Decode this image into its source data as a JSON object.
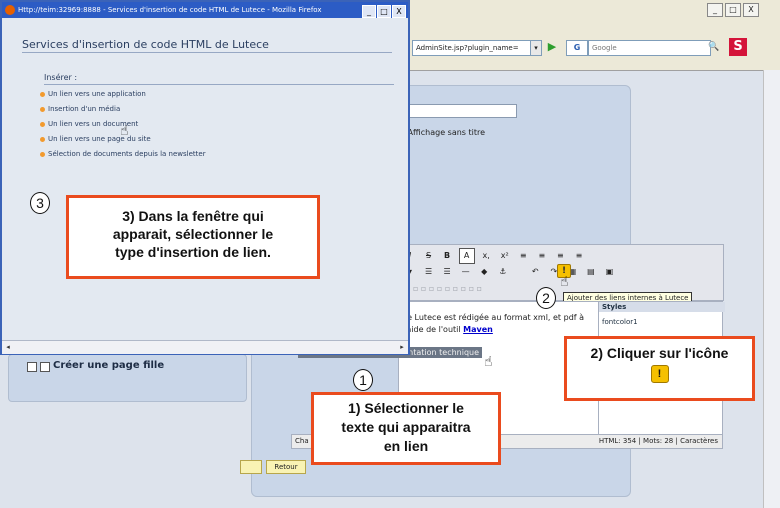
{
  "popup": {
    "window_title": "Http://teim:32969:8888 - Services d'insertion de code HTML de Lutece - Mozilla Firefox",
    "heading": "Services d'insertion de code HTML de Lutece",
    "insert_label": "Insérer :",
    "items": [
      "Un lien vers une application",
      "Insertion d'un média",
      "Un lien vers un document",
      "Un lien vers une page du site",
      "Sélection de documents depuis la newsletter"
    ],
    "controls": [
      "_",
      "□",
      "X"
    ]
  },
  "browser": {
    "url": "AdminSite.jsp?plugin_name=",
    "search_placeholder": "Google",
    "search_engine_icon": "G",
    "logo": "S",
    "window_controls": [
      "_",
      "□",
      "X"
    ]
  },
  "editor": {
    "radio_label": "Affichage sans titre",
    "toolbar_row1": [
      "I",
      "S",
      "B",
      "A",
      "x,",
      "x²"
    ],
    "tooltip": "Ajouter des liens internes à Lutece",
    "body_text": "de Lutece est rédigée au format xml, et pdf à l'aide de l'outil",
    "body_link": "Maven",
    "selected_text": "Présentation de la documentation technique",
    "styles_header": "Styles",
    "styles_item": "fontcolor1",
    "status_left": "Cha",
    "status_right": "HTML: 354 | Mots: 28 | Caractères",
    "retour_button": "Retour"
  },
  "left_panel": {
    "child_page_link": "Créer une page fille"
  },
  "callouts": {
    "step3": [
      "3) Dans la fenêtre qui",
      "apparait, sélectionner le",
      "type d'insertion de lien."
    ],
    "step2": "2) Cliquer sur l'icône",
    "step1": [
      "1) Sélectionner le",
      "texte qui apparaitra",
      "en lien"
    ],
    "step_numbers": [
      "1",
      "2",
      "3"
    ]
  },
  "colors": {
    "callout_border": "#ea4b1e",
    "popup_titlebar": "#2c5cc5",
    "bullet": "#f29a2e"
  }
}
